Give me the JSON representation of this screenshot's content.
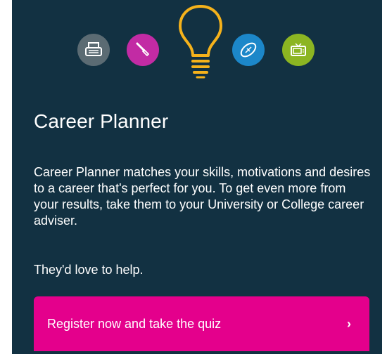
{
  "card": {
    "title": "Career Planner",
    "description": "Career Planner matches your skills, motivations and desires to a career that's perfect for you. To get even more from your results, take them to your University or College career adviser.",
    "help_text": "They'd love to help.",
    "cta": {
      "label": "Register now and take the quiz",
      "chevron": "›"
    }
  },
  "icons": [
    {
      "name": "typewriter-icon",
      "color": "#5b6b73"
    },
    {
      "name": "paintbrush-icon",
      "color": "#c22ba4"
    },
    {
      "name": "lightbulb-icon",
      "color": "#f5b21b"
    },
    {
      "name": "rugby-ball-icon",
      "color": "#1c87c9"
    },
    {
      "name": "television-icon",
      "color": "#8cb522"
    }
  ],
  "colors": {
    "background": "#123142",
    "button": "#e4008c",
    "text": "#ffffff"
  }
}
